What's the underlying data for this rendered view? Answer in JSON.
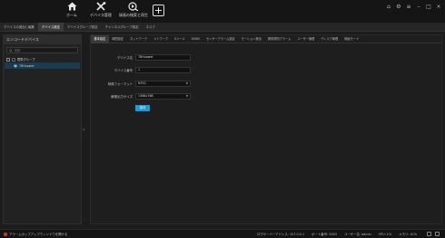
{
  "top_nav": {
    "items": [
      {
        "label": "ホーム",
        "icon": "home-icon"
      },
      {
        "label": "デバイス管理",
        "icon": "tools-icon"
      },
      {
        "label": "録画の検索と再生",
        "icon": "playback-icon"
      }
    ],
    "add_icon": "plus-icon",
    "window_icons": [
      "lock-icon",
      "settings-icon",
      "menu-icon",
      "minimize-icon",
      "maximize-icon",
      "close-icon"
    ]
  },
  "sub_tabs": [
    "デバイスの追加と編集",
    "デバイス設定",
    "デバイスグループ設定",
    "チャンネルグループ設定",
    "ネスク"
  ],
  "sub_tabs_active": 1,
  "left_panel": {
    "title": "エンコードデバイス",
    "search_placeholder": "検索",
    "tree": {
      "group_label": "標準グループ",
      "device_label": "78Huawei"
    }
  },
  "config_tabs": [
    "基本設定",
    "時間設定",
    "ネットワーク",
    "メトワーク",
    "Eメール",
    "DDNS",
    "センサーアラーム設定",
    "モーション検出",
    "異常検知アラーム",
    "ユーザー管理",
    "ディスク管理",
    "録画モード"
  ],
  "config_tabs_active": 0,
  "form": {
    "fields": [
      {
        "label": "デバイス名",
        "value": "78Huawei",
        "type": "text"
      },
      {
        "label": "デバイス番号",
        "value": "1",
        "type": "text"
      },
      {
        "label": "映像フォーマット",
        "value": "NTSC",
        "type": "select"
      },
      {
        "label": "解像出力サイズ",
        "value": "1366x768",
        "type": "select"
      }
    ],
    "save_label": "保存"
  },
  "status_bar": {
    "left_text": "アラームポップアップウィンドウを開ける",
    "server_address": "ログサーバーアドレス: 127.0.0.1",
    "port": "ポート番号: 5003",
    "user": "ユーザー名: admin",
    "cpu": "CPU: 1%",
    "memory": "メモリ: 41%"
  },
  "colors": {
    "accent": "#1a9bd7",
    "warning": "#c9302c"
  }
}
